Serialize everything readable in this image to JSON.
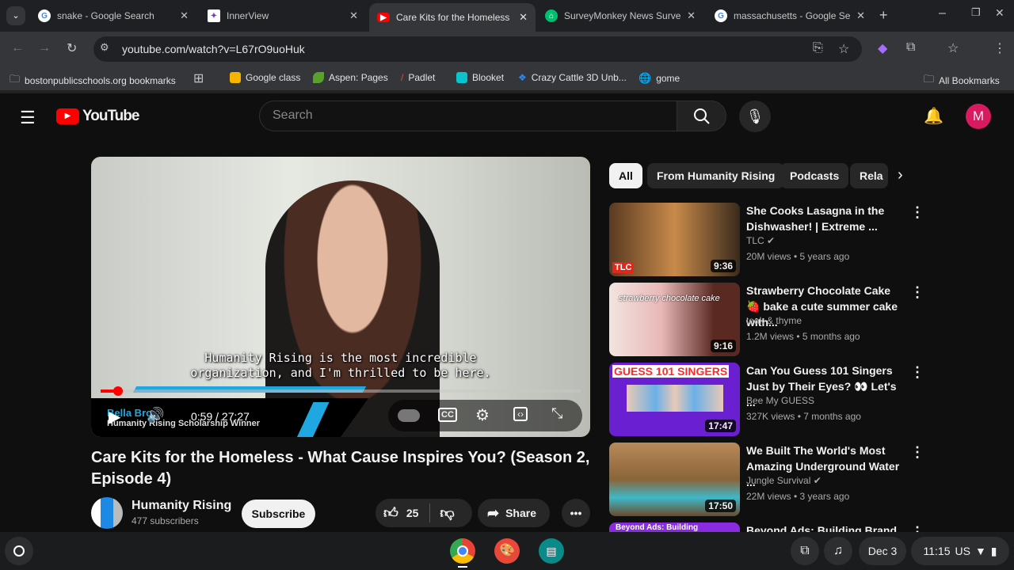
{
  "browser": {
    "tabs": [
      {
        "title": "snake - Google Search",
        "favicon": "google-icon"
      },
      {
        "title": "InnerView",
        "favicon": "innerview-icon"
      },
      {
        "title": "Care Kits for the Homeless",
        "favicon": "youtube-icon",
        "active": true
      },
      {
        "title": "SurveyMonkey News Surve",
        "favicon": "surveymonkey-icon"
      },
      {
        "title": "massachusetts - Google Se",
        "favicon": "google-icon"
      }
    ],
    "url": "youtube.com/watch?v=L67rO9uoHuk",
    "bookmarks": [
      "bostonpublicschools.org bookmarks",
      "Google class",
      "Aspen: Pages",
      "Padlet",
      "Blooket",
      "Crazy Cattle 3D Unb...",
      "gome"
    ],
    "all_bookmarks": "All Bookmarks"
  },
  "youtube": {
    "logo": "YouTube",
    "search_placeholder": "Search",
    "avatar": "M",
    "video": {
      "caption_line1": "Humanity Rising is the most incredible",
      "caption_line2": "organization, and I'm thrilled to be here.",
      "lower_third_name": "Bella Bro",
      "lower_third_title": "Humanity Rising Scholarship Winner",
      "time": "0:59 / 27:27",
      "progress": 0.036
    },
    "title": "Care Kits for the Homeless - What Cause Inspires You? (Season 2, Episode 4)",
    "channel": "Humanity Rising",
    "subscribers": "477 subscribers",
    "subscribe": "Subscribe",
    "likes": "25",
    "share": "Share",
    "chips": [
      "All",
      "From Humanity Rising",
      "Podcasts",
      "Rela"
    ],
    "recommendations": [
      {
        "title": "She Cooks Lasagna in the Dishwasher! | Extreme ...",
        "channel": "TLC",
        "verified": true,
        "meta": "20M views • 5 years ago",
        "duration": "9:36",
        "thumb_text": "TLC"
      },
      {
        "title": "Strawberry Chocolate Cake 🍓 bake a cute summer cake with...",
        "channel": "teak & thyme",
        "verified": false,
        "meta": "1.2M views • 5 months ago",
        "duration": "9:16",
        "thumb_text": "strawberry chocolate cake"
      },
      {
        "title": "Can You Guess 101 Singers Just by Their Eyes? 👀 Let's ...",
        "channel": "Bee My GUESS",
        "verified": false,
        "meta": "327K views • 7 months ago",
        "duration": "17:47",
        "thumb_text": "GUESS 101 SINGERS"
      },
      {
        "title": "We Built The World's Most Amazing Underground Water ...",
        "channel": "Jungle Survival",
        "verified": true,
        "meta": "22M views • 3 years ago",
        "duration": "17:50",
        "thumb_text": ""
      },
      {
        "title": "Beyond Ads: Building Brand",
        "channel": "",
        "verified": false,
        "meta": "",
        "duration": "",
        "thumb_text": "Beyond Ads: Building"
      }
    ]
  },
  "shelf": {
    "date": "Dec 3",
    "time": "11:15",
    "locale": "US"
  }
}
